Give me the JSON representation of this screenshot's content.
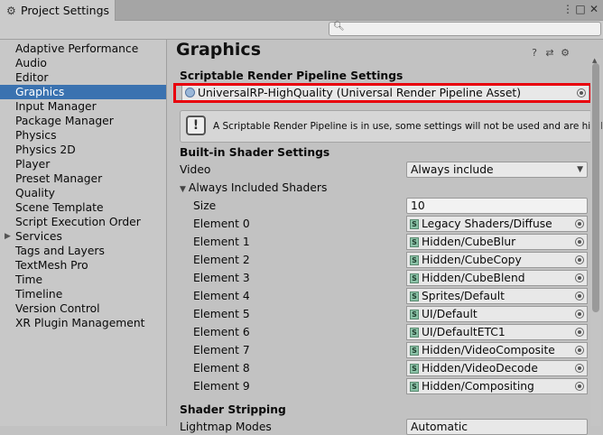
{
  "window": {
    "tab_title": "Project Settings",
    "tab_icon": "gear-icon"
  },
  "sidebar": {
    "items": [
      {
        "label": "Adaptive Performance"
      },
      {
        "label": "Audio"
      },
      {
        "label": "Editor"
      },
      {
        "label": "Graphics",
        "selected": true
      },
      {
        "label": "Input Manager"
      },
      {
        "label": "Package Manager"
      },
      {
        "label": "Physics"
      },
      {
        "label": "Physics 2D"
      },
      {
        "label": "Player"
      },
      {
        "label": "Preset Manager"
      },
      {
        "label": "Quality"
      },
      {
        "label": "Scene Template"
      },
      {
        "label": "Script Execution Order"
      },
      {
        "label": "Services",
        "expandable": true
      },
      {
        "label": "Tags and Layers"
      },
      {
        "label": "TextMesh Pro"
      },
      {
        "label": "Time"
      },
      {
        "label": "Timeline"
      },
      {
        "label": "Version Control"
      },
      {
        "label": "XR Plugin Management"
      }
    ]
  },
  "main": {
    "title": "Graphics",
    "srp": {
      "section_label": "Scriptable Render Pipeline Settings",
      "asset_value": "UniversalRP-HighQuality (Universal Render Pipeline Asset)",
      "highlight_color": "#e8000c"
    },
    "help_message": "A Scriptable Render Pipeline is in use, some settings will not be used and are hidden",
    "builtin": {
      "section_label": "Built-in Shader Settings",
      "video_label": "Video",
      "video_value": "Always include",
      "always_included_label": "Always Included Shaders",
      "size_label": "Size",
      "size_value": "10",
      "elements": [
        {
          "label": "Element 0",
          "value": "Legacy Shaders/Diffuse"
        },
        {
          "label": "Element 1",
          "value": "Hidden/CubeBlur"
        },
        {
          "label": "Element 2",
          "value": "Hidden/CubeCopy"
        },
        {
          "label": "Element 3",
          "value": "Hidden/CubeBlend"
        },
        {
          "label": "Element 4",
          "value": "Sprites/Default"
        },
        {
          "label": "Element 5",
          "value": "UI/Default"
        },
        {
          "label": "Element 6",
          "value": "UI/DefaultETC1"
        },
        {
          "label": "Element 7",
          "value": "Hidden/VideoComposite"
        },
        {
          "label": "Element 8",
          "value": "Hidden/VideoDecode"
        },
        {
          "label": "Element 9",
          "value": "Hidden/Compositing"
        }
      ]
    },
    "stripping": {
      "section_label": "Shader Stripping",
      "lightmap_label": "Lightmap Modes",
      "lightmap_value": "Automatic"
    }
  },
  "colors": {
    "selection": "#3a72b0",
    "background": "#c2c2c2"
  }
}
